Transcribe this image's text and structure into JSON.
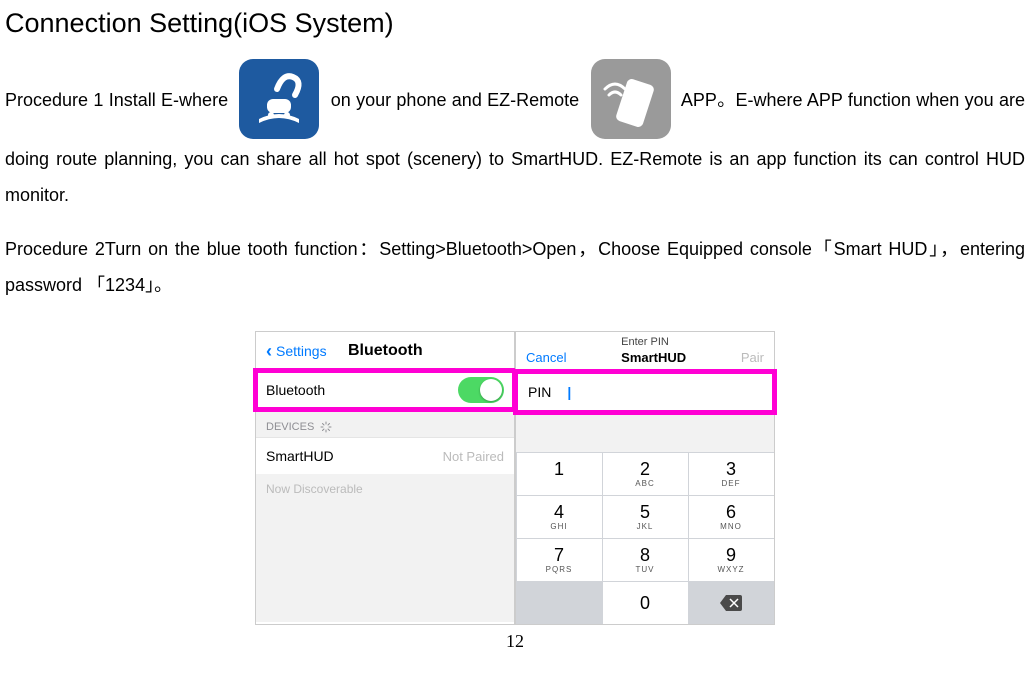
{
  "title": "Connection Setting(iOS System)",
  "para_before_icon1": "Procedure 1 Install E-where",
  "para_between_icons": "on your phone and EZ-Remote",
  "para_after_icon2": "APP。E-where APP function when you are doing route planning, you can share all hot spot (scenery) to SmartHUD. EZ-Remote is an app function its can control HUD monitor.",
  "para2": "Procedure 2Turn on the blue tooth function：Setting>Bluetooth>Open，Choose Equipped console「Smart HUD」，entering password 「1234」。",
  "settings_back": "Settings",
  "settings_title": "Bluetooth",
  "bt_label": "Bluetooth",
  "devices_label": "DEVICES",
  "device_name": "SmartHUD",
  "device_status": "Not Paired",
  "discoverable": "Now Discoverable",
  "pin_enter": "Enter PIN",
  "pin_cancel": "Cancel",
  "pin_device": "SmartHUD",
  "pin_pair": "Pair",
  "pin_label": "PIN",
  "keys": {
    "k1": "1",
    "k2": "2",
    "k2l": "ABC",
    "k3": "3",
    "k3l": "DEF",
    "k4": "4",
    "k4l": "GHI",
    "k5": "5",
    "k5l": "JKL",
    "k6": "6",
    "k6l": "MNO",
    "k7": "7",
    "k7l": "PQRS",
    "k8": "8",
    "k8l": "TUV",
    "k9": "9",
    "k9l": "WXYZ",
    "k0": "0"
  },
  "pagenum": "12"
}
